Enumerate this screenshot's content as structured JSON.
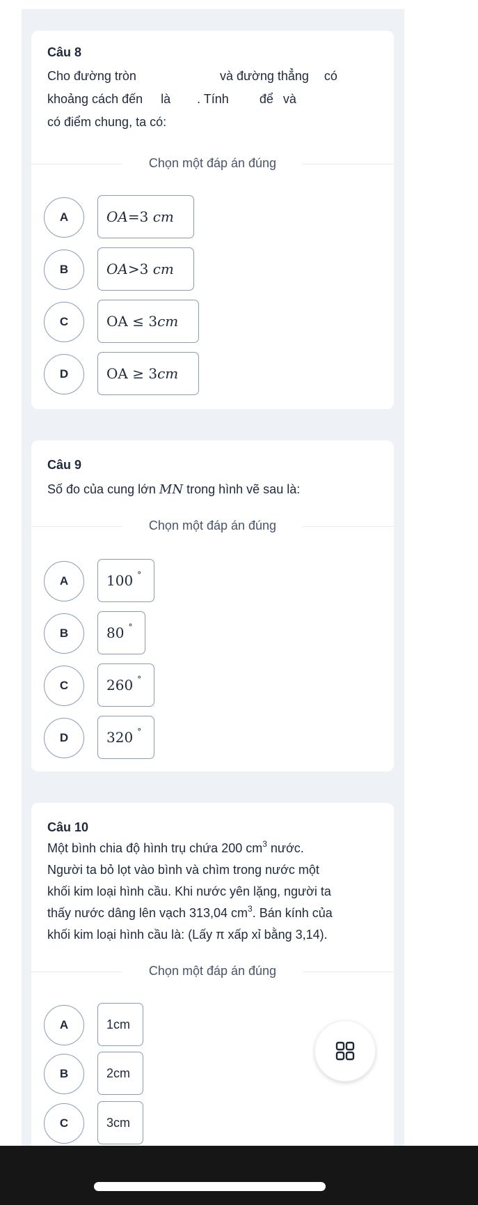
{
  "divider_label": "Chọn một đáp án đúng",
  "questions": [
    {
      "title": "Câu 8",
      "text_parts": [
        "Cho đường tròn",
        "và đường thẳng",
        "có",
        "khoảng cách đến",
        "là",
        ". Tính",
        "để",
        "và",
        "có điểm chung, ta có:"
      ],
      "options": [
        {
          "letter": "A",
          "lhs": "OA",
          "rel": "=",
          "value": "3",
          "unit": "cm"
        },
        {
          "letter": "B",
          "lhs": "OA",
          "rel": ">",
          "value": "3",
          "unit": "cm"
        },
        {
          "letter": "C",
          "lhs": "OA",
          "rel": "≤",
          "value": "3",
          "unit": "cm"
        },
        {
          "letter": "D",
          "lhs": "OA",
          "rel": "≥",
          "value": "3",
          "unit": "cm"
        }
      ]
    },
    {
      "title": "Câu 9",
      "text_before": "Số đo của cung lớn ",
      "text_math": "MN",
      "text_after": " trong hình vẽ sau là:",
      "options": [
        {
          "letter": "A",
          "value": "100",
          "unit": "°"
        },
        {
          "letter": "B",
          "value": "80",
          "unit": "°"
        },
        {
          "letter": "C",
          "value": "260",
          "unit": "°"
        },
        {
          "letter": "D",
          "value": "320",
          "unit": "°"
        }
      ]
    },
    {
      "title": "Câu 10",
      "line1_a": "Một bình chia độ hình trụ chứa 200 cm",
      "line1_sup": "3",
      "line1_b": " nước.",
      "line2": "Người ta bỏ lọt vào bình và chìm trong nước một",
      "line3": "khối kim loại hình cầu. Khi nước yên lặng, người ta",
      "line4_a": "thấy nước dâng lên vạch 313,04 cm",
      "line4_sup": "3",
      "line4_b": ". Bán kính của",
      "line5": "khối kim loại hình cầu là: (Lấy π xấp xỉ bằng 3,14).",
      "options": [
        {
          "letter": "A",
          "value": "1cm"
        },
        {
          "letter": "B",
          "value": "2cm"
        },
        {
          "letter": "C",
          "value": "3cm"
        }
      ]
    }
  ],
  "fab": {
    "icon": "grid-icon"
  },
  "colors": {
    "panel_bg": "#eef1f5",
    "card_bg": "#ffffff",
    "text": "#1e293b",
    "muted": "#475569",
    "border": "#8a9bb8",
    "navbar": "#161616"
  }
}
